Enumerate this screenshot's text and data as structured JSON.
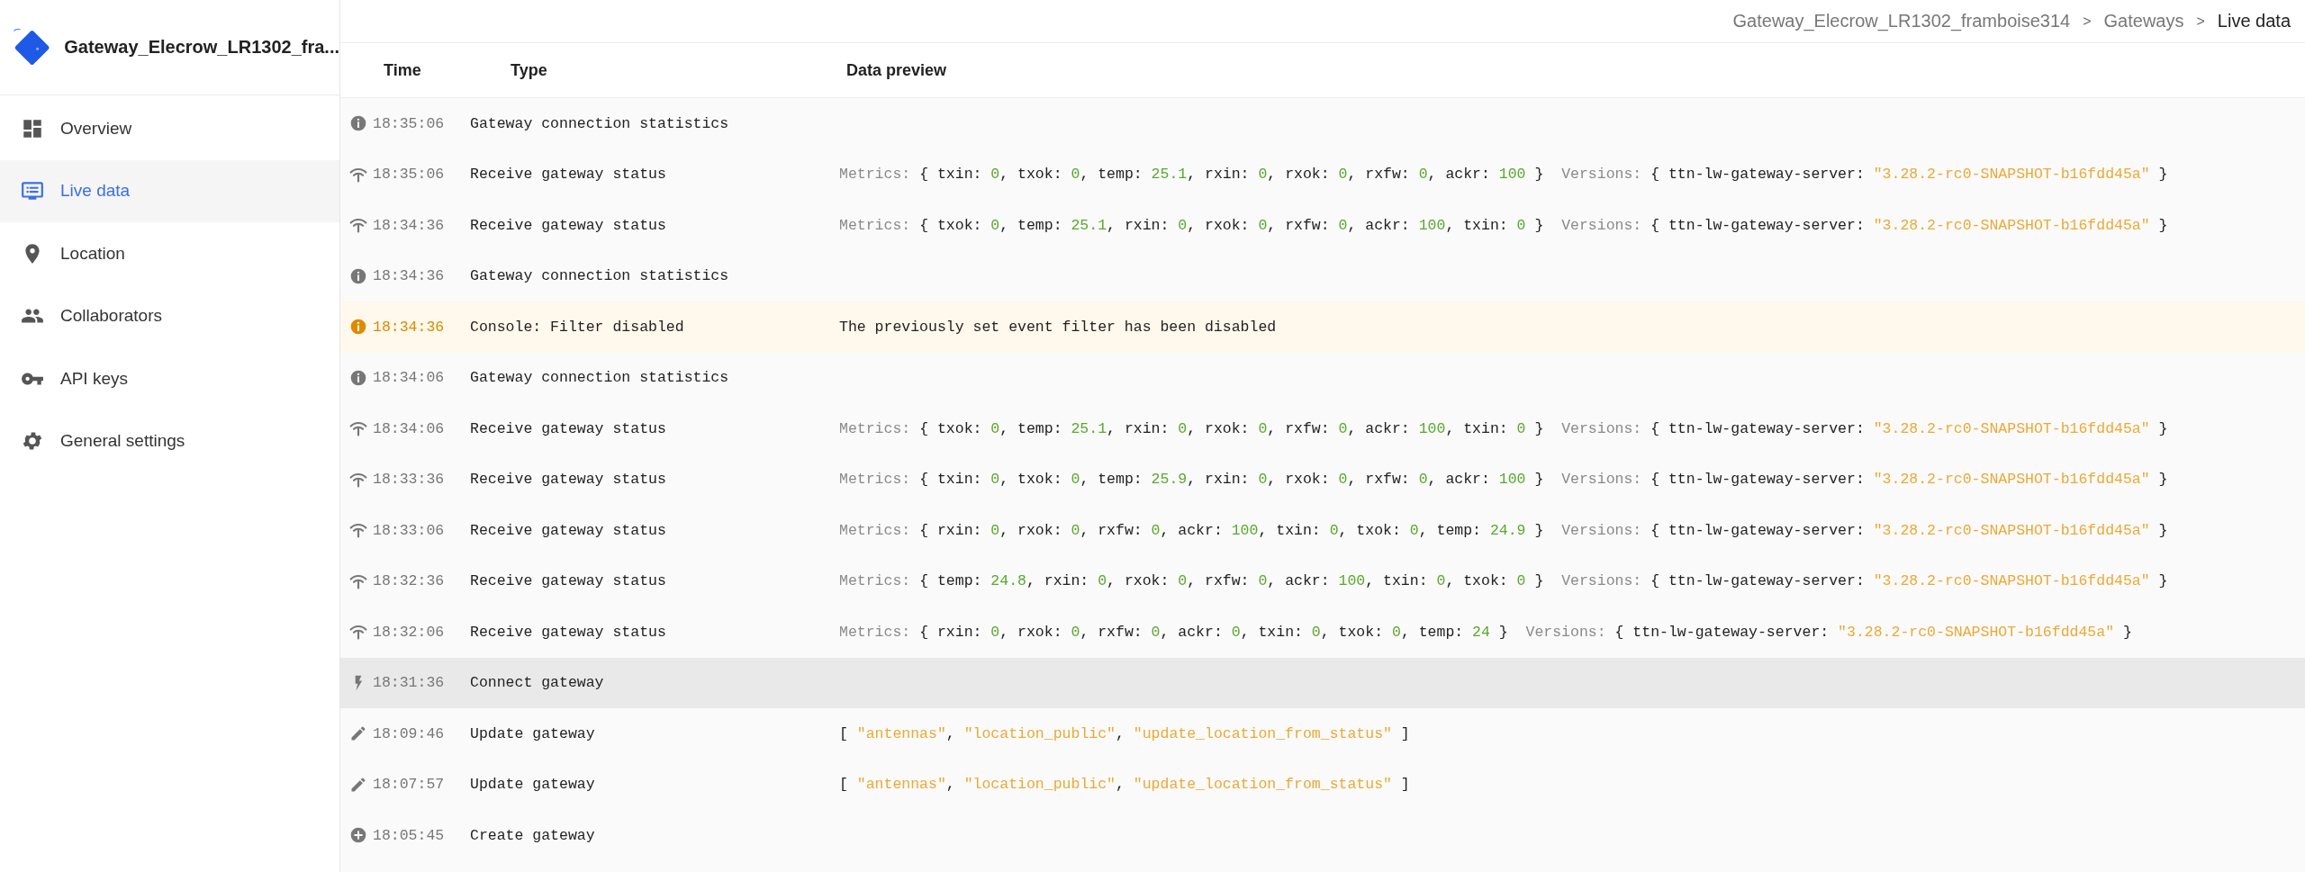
{
  "sidebar": {
    "title": "Gateway_Elecrow_LR1302_fra...",
    "items": [
      {
        "label": "Overview",
        "selected": false
      },
      {
        "label": "Live data",
        "selected": true
      },
      {
        "label": "Location",
        "selected": false
      },
      {
        "label": "Collaborators",
        "selected": false
      },
      {
        "label": "API keys",
        "selected": false
      },
      {
        "label": "General settings",
        "selected": false
      }
    ]
  },
  "breadcrumb": [
    {
      "label": "Gateway_Elecrow_LR1302_framboise314",
      "current": false
    },
    {
      "label": "Gateways",
      "current": false
    },
    {
      "label": "Live data",
      "current": true
    }
  ],
  "breadcrumb_separator": ">",
  "table": {
    "columns": [
      "Time",
      "Type",
      "Data preview"
    ],
    "rows": [
      {
        "kind": "info",
        "time": "18:35:06",
        "type": "Gateway connection statistics",
        "selected": false,
        "preview": []
      },
      {
        "kind": "status",
        "time": "18:35:06",
        "type": "Receive gateway status",
        "selected": false,
        "preview": [
          {
            "kind": "label",
            "text": "Metrics: "
          },
          {
            "kind": "plain",
            "text": "{ txin: "
          },
          {
            "kind": "num",
            "text": "0"
          },
          {
            "kind": "plain",
            "text": ", txok: "
          },
          {
            "kind": "num",
            "text": "0"
          },
          {
            "kind": "plain",
            "text": ", temp: "
          },
          {
            "kind": "num",
            "text": "25.1"
          },
          {
            "kind": "plain",
            "text": ", rxin: "
          },
          {
            "kind": "num",
            "text": "0"
          },
          {
            "kind": "plain",
            "text": ", rxok: "
          },
          {
            "kind": "num",
            "text": "0"
          },
          {
            "kind": "plain",
            "text": ", rxfw: "
          },
          {
            "kind": "num",
            "text": "0"
          },
          {
            "kind": "plain",
            "text": ", ackr: "
          },
          {
            "kind": "num",
            "text": "100"
          },
          {
            "kind": "plain",
            "text": " }  "
          },
          {
            "kind": "label",
            "text": "Versions: "
          },
          {
            "kind": "plain",
            "text": "{ ttn-lw-gateway-server: "
          },
          {
            "kind": "str",
            "text": "\"3.28.2-rc0-SNAPSHOT-b16fdd45a\""
          },
          {
            "kind": "plain",
            "text": " }"
          }
        ]
      },
      {
        "kind": "status",
        "time": "18:34:36",
        "type": "Receive gateway status",
        "selected": false,
        "preview": [
          {
            "kind": "label",
            "text": "Metrics: "
          },
          {
            "kind": "plain",
            "text": "{ txok: "
          },
          {
            "kind": "num",
            "text": "0"
          },
          {
            "kind": "plain",
            "text": ", temp: "
          },
          {
            "kind": "num",
            "text": "25.1"
          },
          {
            "kind": "plain",
            "text": ", rxin: "
          },
          {
            "kind": "num",
            "text": "0"
          },
          {
            "kind": "plain",
            "text": ", rxok: "
          },
          {
            "kind": "num",
            "text": "0"
          },
          {
            "kind": "plain",
            "text": ", rxfw: "
          },
          {
            "kind": "num",
            "text": "0"
          },
          {
            "kind": "plain",
            "text": ", ackr: "
          },
          {
            "kind": "num",
            "text": "100"
          },
          {
            "kind": "plain",
            "text": ", txin: "
          },
          {
            "kind": "num",
            "text": "0"
          },
          {
            "kind": "plain",
            "text": " }  "
          },
          {
            "kind": "label",
            "text": "Versions: "
          },
          {
            "kind": "plain",
            "text": "{ ttn-lw-gateway-server: "
          },
          {
            "kind": "str",
            "text": "\"3.28.2-rc0-SNAPSHOT-b16fdd45a\""
          },
          {
            "kind": "plain",
            "text": " }"
          }
        ]
      },
      {
        "kind": "info",
        "time": "18:34:36",
        "type": "Gateway connection statistics",
        "selected": false,
        "preview": []
      },
      {
        "kind": "warning",
        "time": "18:34:36",
        "type": "Console: Filter disabled",
        "selected": false,
        "preview": [
          {
            "kind": "plain",
            "text": "The previously set event filter has been disabled"
          }
        ]
      },
      {
        "kind": "info",
        "time": "18:34:06",
        "type": "Gateway connection statistics",
        "selected": false,
        "preview": []
      },
      {
        "kind": "status",
        "time": "18:34:06",
        "type": "Receive gateway status",
        "selected": false,
        "preview": [
          {
            "kind": "label",
            "text": "Metrics: "
          },
          {
            "kind": "plain",
            "text": "{ txok: "
          },
          {
            "kind": "num",
            "text": "0"
          },
          {
            "kind": "plain",
            "text": ", temp: "
          },
          {
            "kind": "num",
            "text": "25.1"
          },
          {
            "kind": "plain",
            "text": ", rxin: "
          },
          {
            "kind": "num",
            "text": "0"
          },
          {
            "kind": "plain",
            "text": ", rxok: "
          },
          {
            "kind": "num",
            "text": "0"
          },
          {
            "kind": "plain",
            "text": ", rxfw: "
          },
          {
            "kind": "num",
            "text": "0"
          },
          {
            "kind": "plain",
            "text": ", ackr: "
          },
          {
            "kind": "num",
            "text": "100"
          },
          {
            "kind": "plain",
            "text": ", txin: "
          },
          {
            "kind": "num",
            "text": "0"
          },
          {
            "kind": "plain",
            "text": " }  "
          },
          {
            "kind": "label",
            "text": "Versions: "
          },
          {
            "kind": "plain",
            "text": "{ ttn-lw-gateway-server: "
          },
          {
            "kind": "str",
            "text": "\"3.28.2-rc0-SNAPSHOT-b16fdd45a\""
          },
          {
            "kind": "plain",
            "text": " }"
          }
        ]
      },
      {
        "kind": "status",
        "time": "18:33:36",
        "type": "Receive gateway status",
        "selected": false,
        "preview": [
          {
            "kind": "label",
            "text": "Metrics: "
          },
          {
            "kind": "plain",
            "text": "{ txin: "
          },
          {
            "kind": "num",
            "text": "0"
          },
          {
            "kind": "plain",
            "text": ", txok: "
          },
          {
            "kind": "num",
            "text": "0"
          },
          {
            "kind": "plain",
            "text": ", temp: "
          },
          {
            "kind": "num",
            "text": "25.9"
          },
          {
            "kind": "plain",
            "text": ", rxin: "
          },
          {
            "kind": "num",
            "text": "0"
          },
          {
            "kind": "plain",
            "text": ", rxok: "
          },
          {
            "kind": "num",
            "text": "0"
          },
          {
            "kind": "plain",
            "text": ", rxfw: "
          },
          {
            "kind": "num",
            "text": "0"
          },
          {
            "kind": "plain",
            "text": ", ackr: "
          },
          {
            "kind": "num",
            "text": "100"
          },
          {
            "kind": "plain",
            "text": " }  "
          },
          {
            "kind": "label",
            "text": "Versions: "
          },
          {
            "kind": "plain",
            "text": "{ ttn-lw-gateway-server: "
          },
          {
            "kind": "str",
            "text": "\"3.28.2-rc0-SNAPSHOT-b16fdd45a\""
          },
          {
            "kind": "plain",
            "text": " }"
          }
        ]
      },
      {
        "kind": "status",
        "time": "18:33:06",
        "type": "Receive gateway status",
        "selected": false,
        "preview": [
          {
            "kind": "label",
            "text": "Metrics: "
          },
          {
            "kind": "plain",
            "text": "{ rxin: "
          },
          {
            "kind": "num",
            "text": "0"
          },
          {
            "kind": "plain",
            "text": ", rxok: "
          },
          {
            "kind": "num",
            "text": "0"
          },
          {
            "kind": "plain",
            "text": ", rxfw: "
          },
          {
            "kind": "num",
            "text": "0"
          },
          {
            "kind": "plain",
            "text": ", ackr: "
          },
          {
            "kind": "num",
            "text": "100"
          },
          {
            "kind": "plain",
            "text": ", txin: "
          },
          {
            "kind": "num",
            "text": "0"
          },
          {
            "kind": "plain",
            "text": ", txok: "
          },
          {
            "kind": "num",
            "text": "0"
          },
          {
            "kind": "plain",
            "text": ", temp: "
          },
          {
            "kind": "num",
            "text": "24.9"
          },
          {
            "kind": "plain",
            "text": " }  "
          },
          {
            "kind": "label",
            "text": "Versions: "
          },
          {
            "kind": "plain",
            "text": "{ ttn-lw-gateway-server: "
          },
          {
            "kind": "str",
            "text": "\"3.28.2-rc0-SNAPSHOT-b16fdd45a\""
          },
          {
            "kind": "plain",
            "text": " }"
          }
        ]
      },
      {
        "kind": "status",
        "time": "18:32:36",
        "type": "Receive gateway status",
        "selected": false,
        "preview": [
          {
            "kind": "label",
            "text": "Metrics: "
          },
          {
            "kind": "plain",
            "text": "{ temp: "
          },
          {
            "kind": "num",
            "text": "24.8"
          },
          {
            "kind": "plain",
            "text": ", rxin: "
          },
          {
            "kind": "num",
            "text": "0"
          },
          {
            "kind": "plain",
            "text": ", rxok: "
          },
          {
            "kind": "num",
            "text": "0"
          },
          {
            "kind": "plain",
            "text": ", rxfw: "
          },
          {
            "kind": "num",
            "text": "0"
          },
          {
            "kind": "plain",
            "text": ", ackr: "
          },
          {
            "kind": "num",
            "text": "100"
          },
          {
            "kind": "plain",
            "text": ", txin: "
          },
          {
            "kind": "num",
            "text": "0"
          },
          {
            "kind": "plain",
            "text": ", txok: "
          },
          {
            "kind": "num",
            "text": "0"
          },
          {
            "kind": "plain",
            "text": " }  "
          },
          {
            "kind": "label",
            "text": "Versions: "
          },
          {
            "kind": "plain",
            "text": "{ ttn-lw-gateway-server: "
          },
          {
            "kind": "str",
            "text": "\"3.28.2-rc0-SNAPSHOT-b16fdd45a\""
          },
          {
            "kind": "plain",
            "text": " }"
          }
        ]
      },
      {
        "kind": "status",
        "time": "18:32:06",
        "type": "Receive gateway status",
        "selected": false,
        "preview": [
          {
            "kind": "label",
            "text": "Metrics: "
          },
          {
            "kind": "plain",
            "text": "{ rxin: "
          },
          {
            "kind": "num",
            "text": "0"
          },
          {
            "kind": "plain",
            "text": ", rxok: "
          },
          {
            "kind": "num",
            "text": "0"
          },
          {
            "kind": "plain",
            "text": ", rxfw: "
          },
          {
            "kind": "num",
            "text": "0"
          },
          {
            "kind": "plain",
            "text": ", ackr: "
          },
          {
            "kind": "num",
            "text": "0"
          },
          {
            "kind": "plain",
            "text": ", txin: "
          },
          {
            "kind": "num",
            "text": "0"
          },
          {
            "kind": "plain",
            "text": ", txok: "
          },
          {
            "kind": "num",
            "text": "0"
          },
          {
            "kind": "plain",
            "text": ", temp: "
          },
          {
            "kind": "num",
            "text": "24"
          },
          {
            "kind": "plain",
            "text": " }  "
          },
          {
            "kind": "label",
            "text": "Versions: "
          },
          {
            "kind": "plain",
            "text": "{ ttn-lw-gateway-server: "
          },
          {
            "kind": "str",
            "text": "\"3.28.2-rc0-SNAPSHOT-b16fdd45a\""
          },
          {
            "kind": "plain",
            "text": " }"
          }
        ]
      },
      {
        "kind": "connect",
        "time": "18:31:36",
        "type": "Connect gateway",
        "selected": true,
        "preview": []
      },
      {
        "kind": "update",
        "time": "18:09:46",
        "type": "Update gateway",
        "selected": false,
        "preview": [
          {
            "kind": "plain",
            "text": "[ "
          },
          {
            "kind": "str",
            "text": "\"antennas\""
          },
          {
            "kind": "plain",
            "text": ", "
          },
          {
            "kind": "str",
            "text": "\"location_public\""
          },
          {
            "kind": "plain",
            "text": ", "
          },
          {
            "kind": "str",
            "text": "\"update_location_from_status\""
          },
          {
            "kind": "plain",
            "text": " ]"
          }
        ]
      },
      {
        "kind": "update",
        "time": "18:07:57",
        "type": "Update gateway",
        "selected": false,
        "preview": [
          {
            "kind": "plain",
            "text": "[ "
          },
          {
            "kind": "str",
            "text": "\"antennas\""
          },
          {
            "kind": "plain",
            "text": ", "
          },
          {
            "kind": "str",
            "text": "\"location_public\""
          },
          {
            "kind": "plain",
            "text": ", "
          },
          {
            "kind": "str",
            "text": "\"update_location_from_status\""
          },
          {
            "kind": "plain",
            "text": " ]"
          }
        ]
      },
      {
        "kind": "create",
        "time": "18:05:45",
        "type": "Create gateway",
        "selected": false,
        "preview": []
      }
    ]
  }
}
